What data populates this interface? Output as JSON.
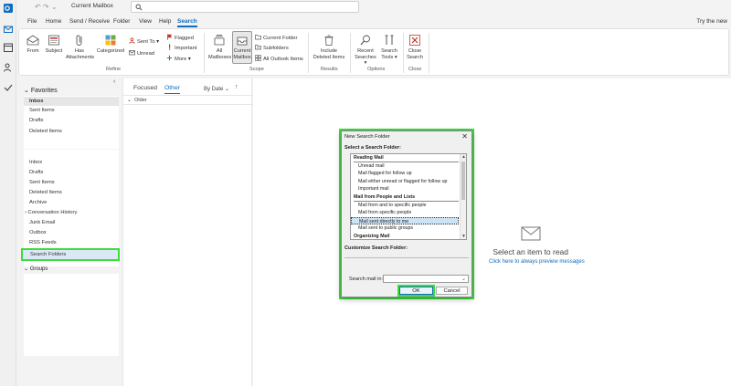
{
  "titlebar": {
    "mailbox_scope": "Current Mailbox",
    "search_placeholder": ""
  },
  "tabs": [
    {
      "label": "File"
    },
    {
      "label": "Home"
    },
    {
      "label": "Send / Receive"
    },
    {
      "label": "Folder"
    },
    {
      "label": "View"
    },
    {
      "label": "Help"
    },
    {
      "label": "Search"
    }
  ],
  "try_text": "Try the new",
  "ribbon": {
    "refine": {
      "from": "From",
      "subject": "Subject",
      "has_attachments_1": "Has",
      "has_attachments_2": "Attachments",
      "categorized": "Categorized",
      "sent_to": "Sent To",
      "unread": "Unread",
      "flagged": "Flagged",
      "important": "Important",
      "more": "More",
      "group": "Refine"
    },
    "scope": {
      "all_mailboxes_1": "All",
      "all_mailboxes_2": "Mailboxes",
      "current_mailbox_1": "Current",
      "current_mailbox_2": "Mailbox",
      "current_folder": "Current Folder",
      "subfolders": "Subfolders",
      "all_outlook_items": "All Outlook Items",
      "group": "Scope"
    },
    "results": {
      "include_1": "Include",
      "include_2": "Deleted Items",
      "group": "Results"
    },
    "options": {
      "recent_1": "Recent",
      "recent_2": "Searches",
      "tools_1": "Search",
      "tools_2": "Tools",
      "group": "Options"
    },
    "close": {
      "close_1": "Close",
      "close_2": "Search",
      "group": "Close"
    }
  },
  "folders": {
    "favorites_head": "Favorites",
    "favorites": [
      "Inbox",
      "Sent Items",
      "Drafts",
      "Deleted Items"
    ],
    "main": [
      "Inbox",
      "Drafts",
      "Sent Items",
      "Deleted Items",
      "Archive",
      "Conversation History",
      "Junk Email",
      "Outbox",
      "RSS Feeds"
    ],
    "search_folders": "Search Folders",
    "groups_head": "Groups"
  },
  "message_list": {
    "focused": "Focused",
    "other": "Other",
    "by_date": "By Date",
    "older": "Older"
  },
  "reading_pane": {
    "empty_title": "Select an item to read",
    "preview_link": "Click here to always preview messages"
  },
  "dialog": {
    "title": "New Search Folder",
    "close": "✕",
    "select_label": "Select a Search Folder:",
    "items": [
      {
        "label": "Reading Mail",
        "kind": "head"
      },
      {
        "label": "Unread mail",
        "kind": "item"
      },
      {
        "label": "Mail flagged for follow up",
        "kind": "item"
      },
      {
        "label": "Mail either unread or flagged for follow up",
        "kind": "item"
      },
      {
        "label": "Important mail",
        "kind": "item"
      },
      {
        "label": "Mail from People and Lists",
        "kind": "head"
      },
      {
        "label": "Mail from and to specific people",
        "kind": "item"
      },
      {
        "label": "Mail from specific people",
        "kind": "item"
      },
      {
        "label": "Mail sent directly to me",
        "kind": "selected"
      },
      {
        "label": "Mail sent to public groups",
        "kind": "item"
      },
      {
        "label": "Organizing Mail",
        "kind": "head"
      }
    ],
    "customize_label": "Customize Search Folder:",
    "search_in_label": "Search mail in:",
    "search_in_value": "",
    "ok": "OK",
    "cancel": "Cancel"
  },
  "colors": {
    "accent": "#0f6cbd",
    "highlight": "#3ddc3d"
  }
}
